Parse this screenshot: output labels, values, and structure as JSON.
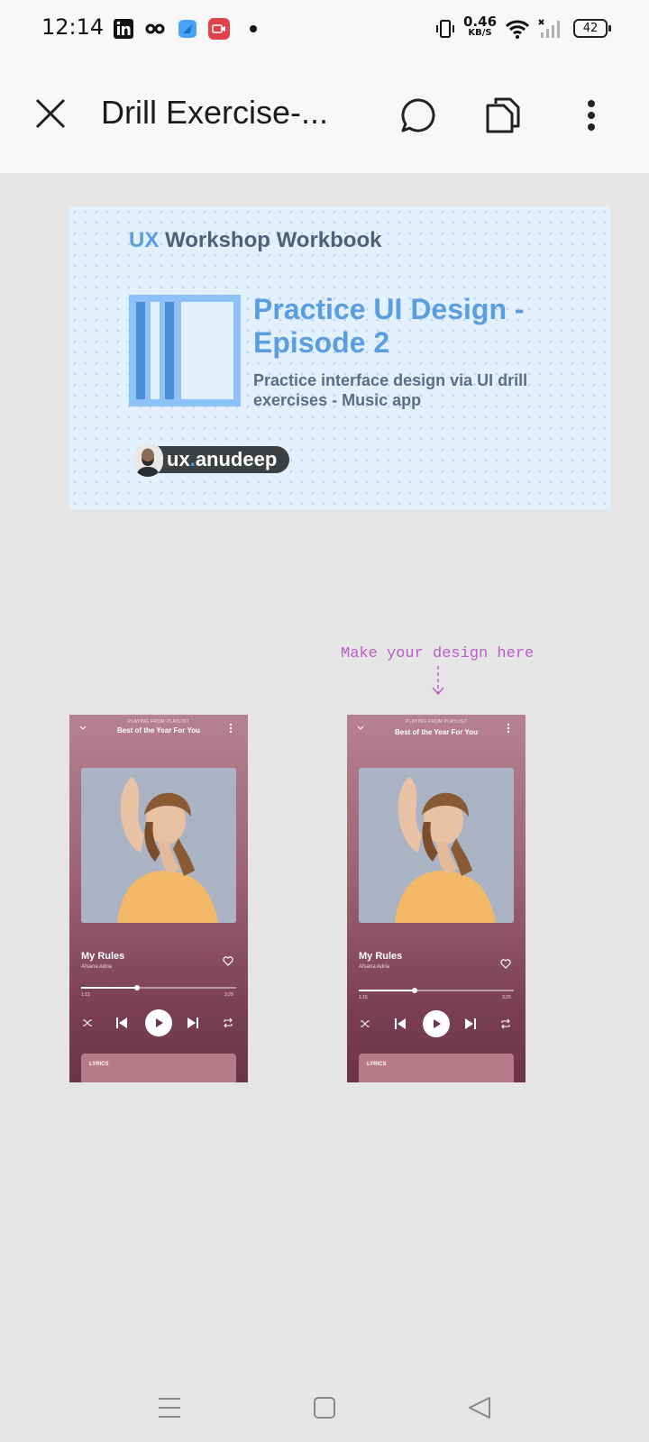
{
  "status_bar": {
    "time": "12:14",
    "net_speed_value": "0.46",
    "net_speed_unit": "KB/S",
    "battery": "42",
    "icons": [
      "linkedin-icon",
      "glasses-icon",
      "blue-app-icon",
      "screen-recorder-icon",
      "notification-dot-icon",
      "vibrate-icon",
      "wifi-icon",
      "signal-icon",
      "battery-icon"
    ]
  },
  "toolbar": {
    "title": "Drill Exercise-...",
    "icons": [
      "close-icon",
      "comment-icon",
      "pages-icon",
      "more-vert-icon"
    ]
  },
  "cover": {
    "brand_ux": "UX",
    "brand_rest": " Workshop Workbook",
    "episode_title": "Practice UI Design - Episode 2",
    "episode_subtitle": "Practice interface design via UI drill exercises - Music app",
    "handle_prefix": "ux",
    "handle_dot": ".",
    "handle_name": "anudeep"
  },
  "hint": "Make your design here",
  "phones": [
    {
      "playing_from": "PLAYING FROM PLAYLIST",
      "playlist": "Best of the Year For You",
      "song": "My Rules",
      "artist": "Afsana Adria",
      "elapsed": "1:15",
      "duration": "3:29",
      "progress": 0.36,
      "lyrics_label": "LYRICS"
    },
    {
      "playing_from": "PLAYING FROM PLAYLIST",
      "playlist": "Best of the Year For You",
      "song": "My Rules",
      "artist": "Afsana Adria",
      "elapsed": "1:15",
      "duration": "3:29",
      "progress": 0.36,
      "lyrics_label": "LYRICS"
    }
  ],
  "nav_bar": {
    "icons": [
      "menu-icon",
      "home-square-icon",
      "back-triangle-icon"
    ]
  },
  "colors": {
    "accent_blue": "#5a9de0",
    "hint_purple": "#b95ec6",
    "player_bg": "#9c6274"
  }
}
